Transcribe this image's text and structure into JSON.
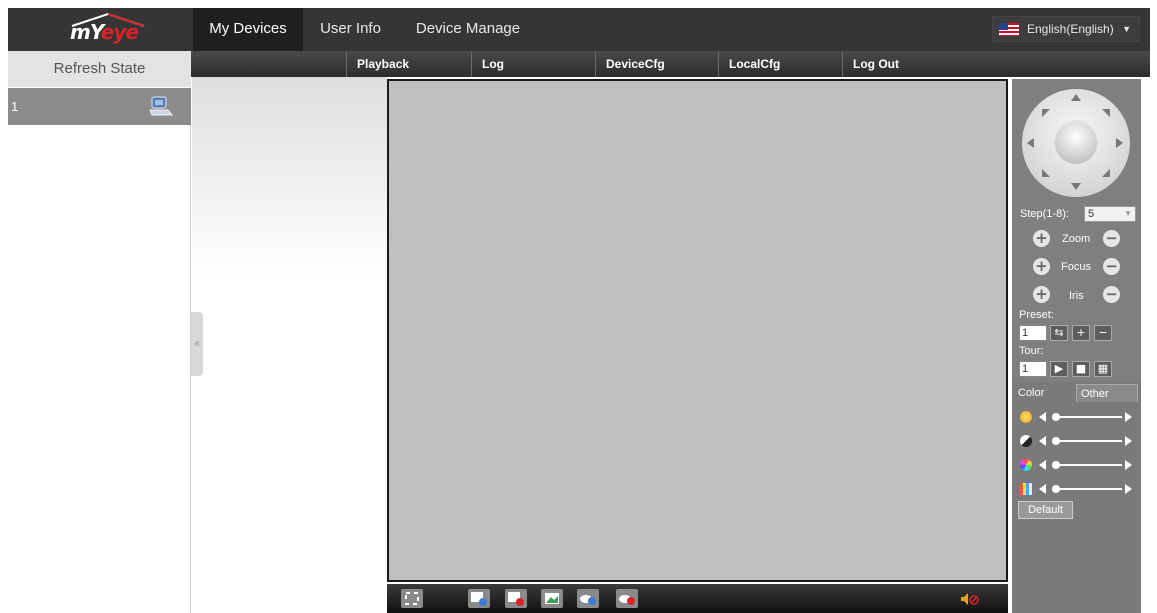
{
  "logo": {
    "text_main": "mY",
    "text_accent": "eye"
  },
  "nav": {
    "tabs": [
      {
        "label": "My Devices",
        "active": true
      },
      {
        "label": "User Info",
        "active": false
      },
      {
        "label": "Device Manage",
        "active": false
      }
    ]
  },
  "language": {
    "selected": "English(English)",
    "icon": "us-flag-icon"
  },
  "subnav": {
    "items": [
      "Playback",
      "Log",
      "DeviceCfg",
      "LocalCfg",
      "Log Out"
    ]
  },
  "sidebar": {
    "refresh_label": "Refresh State",
    "devices": [
      {
        "number": "1",
        "icon": "camera-device-icon"
      }
    ],
    "collapse_glyph": "«"
  },
  "ptz": {
    "step_label": "Step(1-8):",
    "step_value": "5",
    "zoom_label": "Zoom",
    "focus_label": "Focus",
    "iris_label": "Iris",
    "preset_label": "Preset:",
    "preset_value": "1",
    "tour_label": "Tour:",
    "tour_value": "1"
  },
  "image_settings": {
    "tabs": [
      "Color",
      "Other"
    ],
    "active_tab": "Color",
    "sliders": [
      {
        "name": "brightness",
        "icon": "brightness-icon",
        "level": 0.05
      },
      {
        "name": "contrast",
        "icon": "contrast-icon",
        "level": 0.05
      },
      {
        "name": "saturation",
        "icon": "saturation-icon",
        "level": 0.05
      },
      {
        "name": "hue",
        "icon": "hue-icon",
        "level": 0.05
      }
    ],
    "default_label": "Default"
  },
  "video_toolbar": {
    "buttons": [
      "fullscreen-icon",
      "playback-icon",
      "record-icon",
      "snapshot-icon",
      "talk-icon",
      "stop-talk-icon"
    ],
    "audio_icon": "mute-icon"
  },
  "colors": {
    "topbar": "#353535",
    "accent_red": "#d8232a",
    "video_bg": "#c0c0c0",
    "panel": "#7c7c7c"
  }
}
